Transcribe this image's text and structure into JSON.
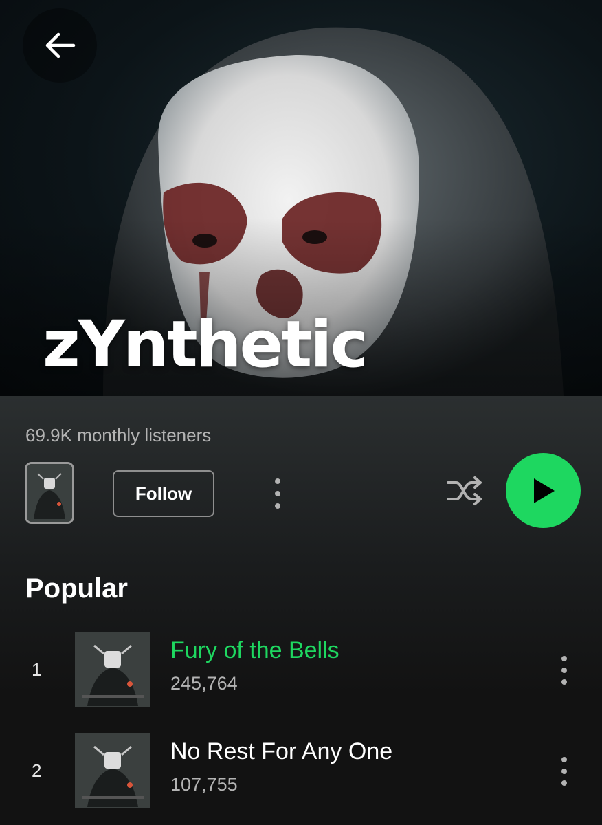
{
  "hero": {
    "artist_name": "zYnthetic",
    "back_icon": "arrow-left-icon"
  },
  "info": {
    "monthly_listeners": "69.9K monthly listeners",
    "follow_label": "Follow",
    "more_icon": "more-vertical-icon",
    "shuffle_icon": "shuffle-icon",
    "play_icon": "play-icon"
  },
  "popular": {
    "title": "Popular",
    "tracks": [
      {
        "number": "1",
        "title": "Fury of the Bells",
        "plays": "245,764",
        "active": true
      },
      {
        "number": "2",
        "title": "No Rest For Any One",
        "plays": "107,755",
        "active": false
      }
    ]
  },
  "colors": {
    "accent": "#1ed760",
    "background": "#121212",
    "secondary_text": "#b3b3b3"
  }
}
